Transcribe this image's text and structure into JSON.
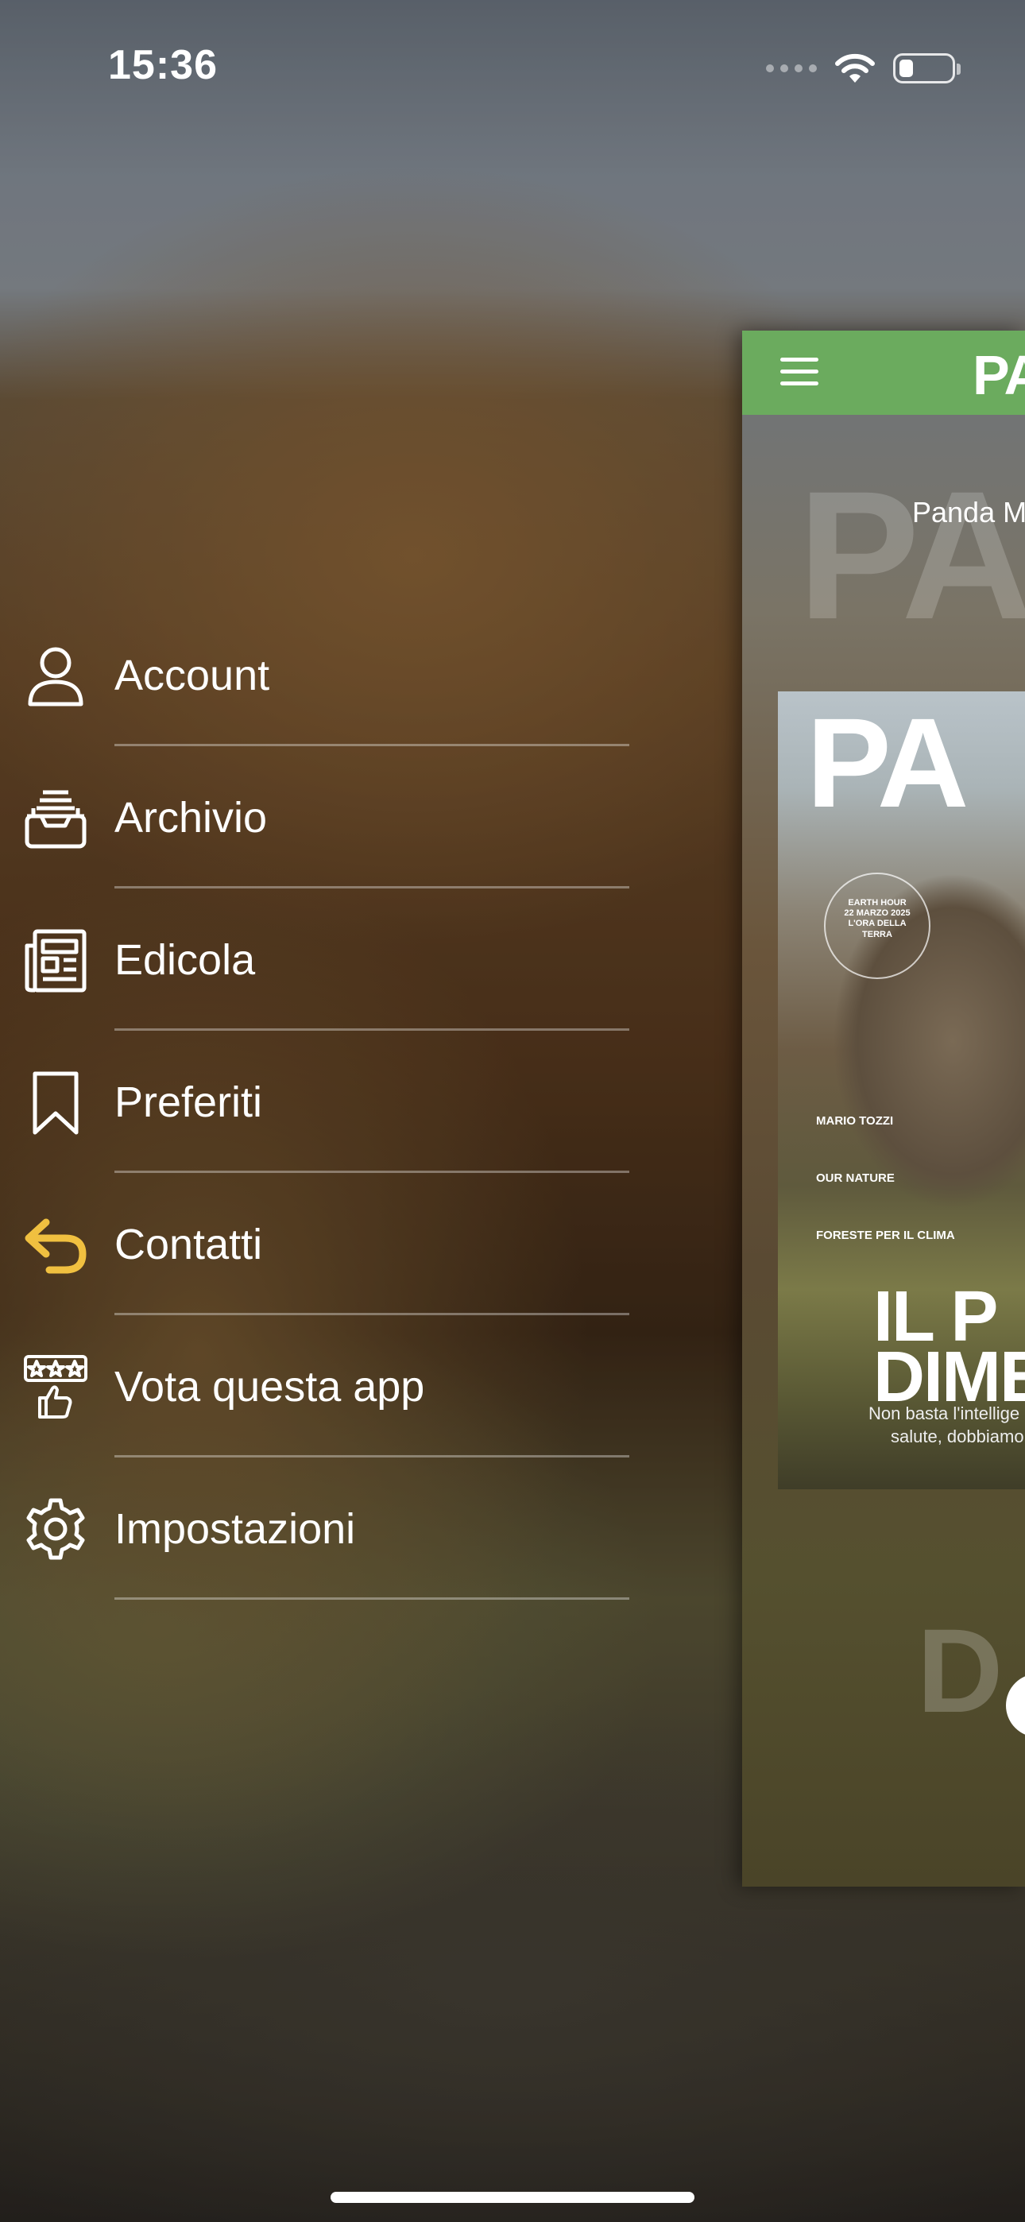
{
  "status_bar": {
    "time": "15:36",
    "battery_level": 0.28
  },
  "menu": {
    "items": [
      {
        "label": "Account",
        "icon": "person-icon"
      },
      {
        "label": "Archivio",
        "icon": "archive-tray-icon"
      },
      {
        "label": "Edicola",
        "icon": "newspaper-icon"
      },
      {
        "label": "Preferiti",
        "icon": "bookmark-icon"
      },
      {
        "label": "Contatti",
        "icon": "reply-arrow-icon"
      },
      {
        "label": "Vota questa app",
        "icon": "rate-app-icon"
      },
      {
        "label": "Impostazioni",
        "icon": "gear-icon"
      }
    ]
  },
  "preview": {
    "header_color": "#6bab5e",
    "brand_partial": "PA",
    "subtitle": "Panda M",
    "ghost_text": "PA",
    "cover": {
      "title_partial": "PA",
      "seal_text": "EARTH HOUR 22 MARZO 2025 L'ORA DELLA TERRA",
      "section1_title": "MARIO TOZZI",
      "section2_title": "OUR NATURE",
      "section3_title": "FORESTE PER IL CLIMA",
      "headline_line1": "IL P",
      "headline_line2": "DIME",
      "tagline_line1": "Non basta l'intellige",
      "tagline_line2": "salute, dobbiamo d"
    },
    "ghost_text2": "D"
  },
  "accent_colors": {
    "contatti_icon": "#f0c040",
    "menu_text": "#ffffff"
  }
}
